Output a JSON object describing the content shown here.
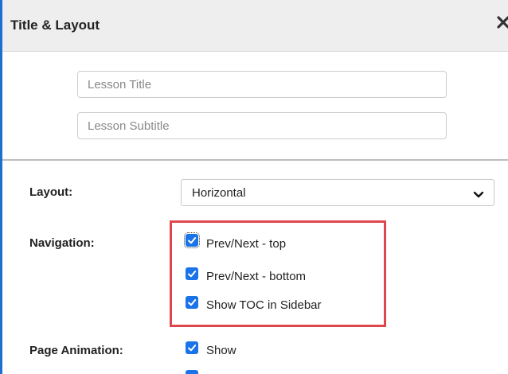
{
  "dialog": {
    "title": "Title & Layout",
    "close_glyph": "✕"
  },
  "inputs": {
    "title_placeholder": "Lesson Title",
    "subtitle_placeholder": "Lesson Subtitle",
    "title_value": "",
    "subtitle_value": ""
  },
  "layout": {
    "label": "Layout:",
    "selected": "Horizontal"
  },
  "navigation": {
    "label": "Navigation:",
    "options": [
      {
        "label": "Prev/Next - top",
        "checked": true
      },
      {
        "label": "Prev/Next - bottom",
        "checked": true
      },
      {
        "label": "Show TOC in Sidebar",
        "checked": true
      }
    ],
    "highlight_color": "#e0474c"
  },
  "page_animation": {
    "label": "Page Animation:",
    "options": [
      {
        "label": "Show",
        "checked": true
      }
    ]
  },
  "colors": {
    "accent": "#1a73e8",
    "frame": "#1f6fd1"
  }
}
